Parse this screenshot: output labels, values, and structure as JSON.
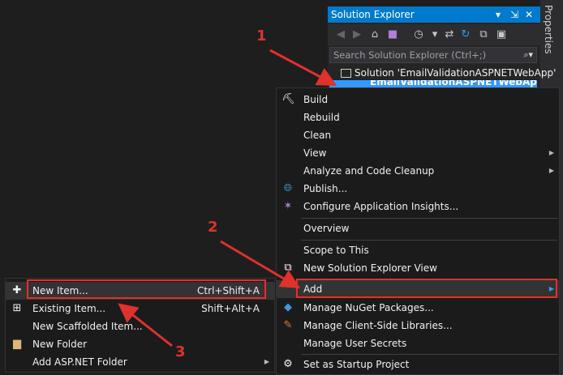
{
  "properties_tab": "Properties",
  "solution_explorer": {
    "title": "Solution Explorer",
    "title_buttons": [
      "▾",
      "⇲",
      "✕"
    ],
    "search_placeholder": "Search Solution Explorer (Ctrl+;)",
    "solution_row": "Solution 'EmailValidationASPNETWebApp'",
    "project_row": "EmailValidationASPNETWebApp"
  },
  "main_menu": {
    "items": [
      {
        "label": "Build",
        "icon": "build-icon"
      },
      {
        "label": "Rebuild"
      },
      {
        "label": "Clean"
      },
      {
        "label": "View",
        "submenu": true
      },
      {
        "label": "Analyze and Code Cleanup",
        "submenu": true
      },
      {
        "label": "Publish...",
        "icon": "globe-icon"
      },
      {
        "label": "Configure Application Insights...",
        "icon": "bulb-icon"
      },
      {
        "label": "Overview"
      },
      {
        "label": "Scope to This"
      },
      {
        "label": "New Solution Explorer View",
        "icon": "new-view-icon"
      },
      {
        "label": "Add",
        "submenu": true
      },
      {
        "label": "Manage NuGet Packages...",
        "icon": "nuget-icon"
      },
      {
        "label": "Manage Client-Side Libraries...",
        "icon": "library-icon"
      },
      {
        "label": "Manage User Secrets"
      },
      {
        "label": "Set as Startup Project",
        "icon": "gear-icon"
      }
    ]
  },
  "add_submenu": {
    "items": [
      {
        "label": "New Item...",
        "shortcut": "Ctrl+Shift+A",
        "icon": "new-item-icon"
      },
      {
        "label": "Existing Item...",
        "shortcut": "Shift+Alt+A",
        "icon": "existing-item-icon"
      },
      {
        "label": "New Scaffolded Item..."
      },
      {
        "label": "New Folder",
        "icon": "folder-icon"
      },
      {
        "label": "Add ASP.NET Folder",
        "submenu": true
      }
    ]
  },
  "callouts": [
    "1",
    "2",
    "3"
  ],
  "colors": {
    "accent": "#007acc",
    "annotation": "#e0312b",
    "selection": "#3399ff"
  }
}
